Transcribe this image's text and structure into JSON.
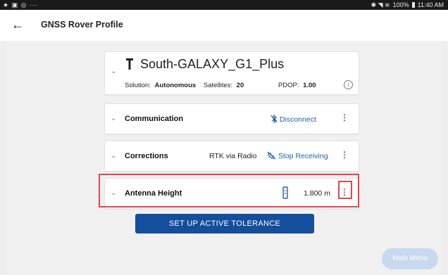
{
  "status_bar": {
    "left_icons": "★ ▣ ◎ ···",
    "right_icons": "✱ ◥ ≋",
    "battery": "100%",
    "time": "11:40 AM"
  },
  "app_bar": {
    "back_icon": "back-arrow-icon",
    "title": "GNSS Rover Profile"
  },
  "receiver": {
    "name": "South-GALAXY_G1_Plus",
    "solution_label": "Solution:",
    "solution_value": "Autonomous",
    "satellites_label": "Satellites:",
    "satellites_value": "20",
    "pdop_label": "PDOP:",
    "pdop_value": "1.00",
    "info_icon": "i"
  },
  "communication": {
    "label": "Communication",
    "action": "Disconnect",
    "action_icon": "bluetooth-off-icon"
  },
  "corrections": {
    "label": "Corrections",
    "mode": "RTK via Radio",
    "action": "Stop Receiving",
    "action_icon": "satellite-dish-off-icon"
  },
  "antenna": {
    "label": "Antenna Height",
    "value": "1.800 m",
    "icon": "antenna-rod-icon"
  },
  "buttons": {
    "primary": "SET UP ACTIVE TOLERANCE",
    "fab": "Main Menu"
  },
  "colors": {
    "accent": "#1f5fb4",
    "primary_button": "#144e9c",
    "highlight": "#e0474c",
    "fab": "#c8d8ef"
  }
}
